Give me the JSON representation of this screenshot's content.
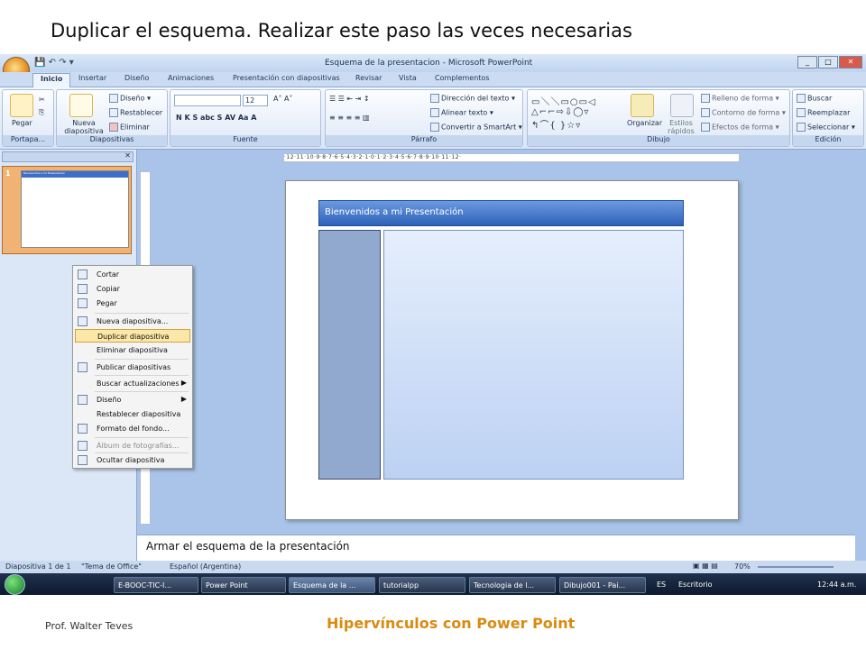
{
  "heading": "Duplicar el esquema. Realizar este paso las veces necesarias",
  "footer": {
    "author": "Prof. Walter Teves",
    "title": "Hipervínculos con Power Point"
  },
  "window": {
    "title": "Esquema de la presentacion - Microsoft PowerPoint"
  },
  "tabs": [
    "Inicio",
    "Insertar",
    "Diseño",
    "Animaciones",
    "Presentación con diapositivas",
    "Revisar",
    "Vista",
    "Complementos"
  ],
  "ribbon": {
    "portapapeles": {
      "label": "Portapa...",
      "pegar": "Pegar"
    },
    "diapositivas": {
      "label": "Diapositivas",
      "nueva": "Nueva diapositiva",
      "diseno": "Diseño",
      "restablecer": "Restablecer",
      "eliminar": "Eliminar"
    },
    "fuente": {
      "label": "Fuente",
      "size": "12"
    },
    "parrafo": {
      "label": "Párrafo",
      "direccion": "Dirección del texto",
      "alinear": "Alinear texto",
      "smartart": "Convertir a SmartArt"
    },
    "dibujo": {
      "label": "Dibujo",
      "organizar": "Organizar",
      "estilos": "Estilos rápidos",
      "relleno": "Relleno de forma",
      "contorno": "Contorno de forma",
      "efectos": "Efectos de forma"
    },
    "edicion": {
      "label": "Edición",
      "buscar": "Buscar",
      "reemplazar": "Reemplazar",
      "seleccionar": "Seleccionar"
    }
  },
  "slide": {
    "number": "1",
    "title": "Bienvenidos a mi Presentación",
    "thumb_title": "Bienvenidos a mi Presentación"
  },
  "ruler": "·12·11·10·9·8·7·6·5·4·3·2·1·0·1·2·3·4·5·6·7·8·9·10·11·12·",
  "context_menu": [
    {
      "label": "Cortar"
    },
    {
      "label": "Copiar"
    },
    {
      "label": "Pegar"
    },
    {
      "label": "Nueva diapositiva..."
    },
    {
      "label": "Duplicar diapositiva"
    },
    {
      "label": "Eliminar diapositiva"
    },
    {
      "label": "Publicar diapositivas"
    },
    {
      "label": "Buscar actualizaciones"
    },
    {
      "label": "Diseño"
    },
    {
      "label": "Restablecer diapositiva"
    },
    {
      "label": "Formato del fondo..."
    },
    {
      "label": "Álbum de fotografías..."
    },
    {
      "label": "Ocultar diapositiva"
    }
  ],
  "notes": "Armar el esquema de la presentación",
  "status": {
    "slide": "Diapositiva 1 de 1",
    "theme": "\"Tema de Office\"",
    "language": "Español (Argentina)",
    "zoom": "70%"
  },
  "taskbar": {
    "items": [
      "E-BOOC-TIC-I...",
      "Power Point",
      "Esquema de la ...",
      "tutorialpp",
      "Tecnologia de l...",
      "Dibujo001 - Pai..."
    ],
    "lang": "ES",
    "desktop": "Escritorio",
    "time": "12:44 a.m."
  }
}
